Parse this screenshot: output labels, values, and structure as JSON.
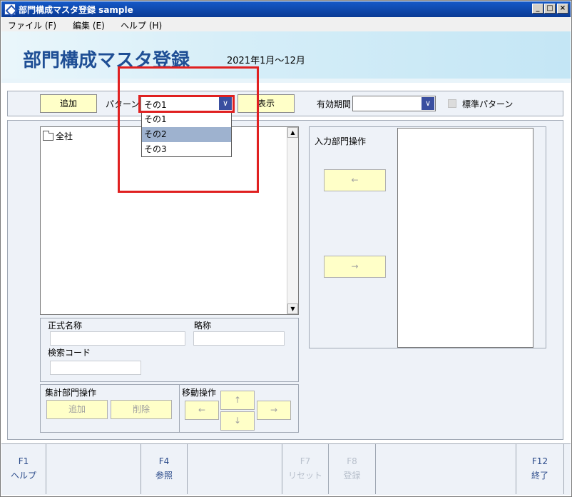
{
  "window": {
    "title": "部門構成マスタ登録 sample",
    "controls": {
      "minimize": "_",
      "maximize": "□",
      "close": "×"
    }
  },
  "menu": {
    "items": [
      "ファイル (F)",
      "編集 (E)",
      "ヘルプ (H)"
    ]
  },
  "banner": {
    "title": "部門構成マスタ登録",
    "period": "2021年1月～12月"
  },
  "toolbar": {
    "add_button": "追加",
    "pattern_label": "パターン",
    "pattern_value": "その1",
    "pattern_options": [
      "その1",
      "その2",
      "その3"
    ],
    "pattern_selected_index": 1,
    "show_button": "表示",
    "valid_period_label": "有効期間",
    "valid_period_value": "",
    "standard_pattern_label": "標準パターン"
  },
  "tree": {
    "root_label": "全社"
  },
  "details": {
    "formal_name_label": "正式名称",
    "short_name_label": "略称",
    "search_code_label": "検索コード"
  },
  "aggregate": {
    "title": "集計部門操作",
    "add_button": "追加",
    "delete_button": "削除"
  },
  "move": {
    "title": "移動操作",
    "up": "↑",
    "down": "↓",
    "left": "←",
    "right": "→"
  },
  "input_dept": {
    "title": "入力部門操作",
    "left": "←",
    "right": "→"
  },
  "fkeys": [
    {
      "key": "F1",
      "label": "ヘルプ"
    },
    {
      "key": "F4",
      "label": "参照"
    },
    {
      "key": "F7",
      "label": "リセット"
    },
    {
      "key": "F8",
      "label": "登録"
    },
    {
      "key": "F12",
      "label": "終了"
    }
  ],
  "colors": {
    "button_fill": "#ffffc8",
    "combo_arrow": "#3a4fa0",
    "banner_title": "#1f4f95",
    "highlight": "#e02020",
    "selected_item": "#9eb2cf"
  }
}
